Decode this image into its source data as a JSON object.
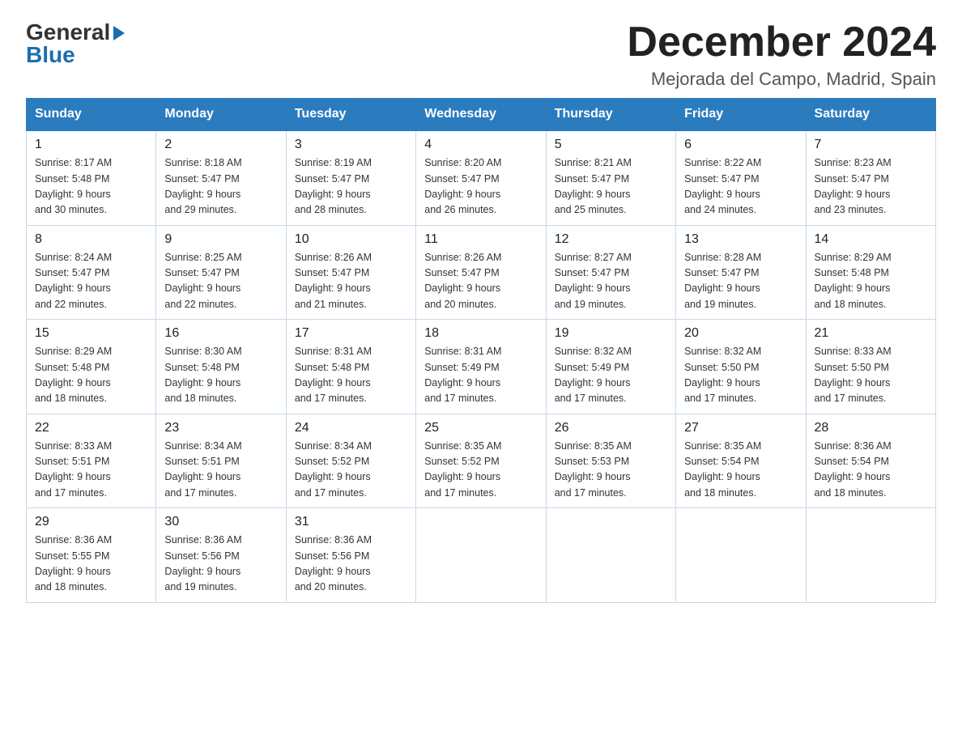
{
  "header": {
    "logo_general": "General",
    "logo_blue": "Blue",
    "month_title": "December 2024",
    "location": "Mejorada del Campo, Madrid, Spain"
  },
  "weekdays": [
    "Sunday",
    "Monday",
    "Tuesday",
    "Wednesday",
    "Thursday",
    "Friday",
    "Saturday"
  ],
  "weeks": [
    [
      {
        "day": "1",
        "sunrise": "8:17 AM",
        "sunset": "5:48 PM",
        "daylight": "9 hours and 30 minutes."
      },
      {
        "day": "2",
        "sunrise": "8:18 AM",
        "sunset": "5:47 PM",
        "daylight": "9 hours and 29 minutes."
      },
      {
        "day": "3",
        "sunrise": "8:19 AM",
        "sunset": "5:47 PM",
        "daylight": "9 hours and 28 minutes."
      },
      {
        "day": "4",
        "sunrise": "8:20 AM",
        "sunset": "5:47 PM",
        "daylight": "9 hours and 26 minutes."
      },
      {
        "day": "5",
        "sunrise": "8:21 AM",
        "sunset": "5:47 PM",
        "daylight": "9 hours and 25 minutes."
      },
      {
        "day": "6",
        "sunrise": "8:22 AM",
        "sunset": "5:47 PM",
        "daylight": "9 hours and 24 minutes."
      },
      {
        "day": "7",
        "sunrise": "8:23 AM",
        "sunset": "5:47 PM",
        "daylight": "9 hours and 23 minutes."
      }
    ],
    [
      {
        "day": "8",
        "sunrise": "8:24 AM",
        "sunset": "5:47 PM",
        "daylight": "9 hours and 22 minutes."
      },
      {
        "day": "9",
        "sunrise": "8:25 AM",
        "sunset": "5:47 PM",
        "daylight": "9 hours and 22 minutes."
      },
      {
        "day": "10",
        "sunrise": "8:26 AM",
        "sunset": "5:47 PM",
        "daylight": "9 hours and 21 minutes."
      },
      {
        "day": "11",
        "sunrise": "8:26 AM",
        "sunset": "5:47 PM",
        "daylight": "9 hours and 20 minutes."
      },
      {
        "day": "12",
        "sunrise": "8:27 AM",
        "sunset": "5:47 PM",
        "daylight": "9 hours and 19 minutes."
      },
      {
        "day": "13",
        "sunrise": "8:28 AM",
        "sunset": "5:47 PM",
        "daylight": "9 hours and 19 minutes."
      },
      {
        "day": "14",
        "sunrise": "8:29 AM",
        "sunset": "5:48 PM",
        "daylight": "9 hours and 18 minutes."
      }
    ],
    [
      {
        "day": "15",
        "sunrise": "8:29 AM",
        "sunset": "5:48 PM",
        "daylight": "9 hours and 18 minutes."
      },
      {
        "day": "16",
        "sunrise": "8:30 AM",
        "sunset": "5:48 PM",
        "daylight": "9 hours and 18 minutes."
      },
      {
        "day": "17",
        "sunrise": "8:31 AM",
        "sunset": "5:48 PM",
        "daylight": "9 hours and 17 minutes."
      },
      {
        "day": "18",
        "sunrise": "8:31 AM",
        "sunset": "5:49 PM",
        "daylight": "9 hours and 17 minutes."
      },
      {
        "day": "19",
        "sunrise": "8:32 AM",
        "sunset": "5:49 PM",
        "daylight": "9 hours and 17 minutes."
      },
      {
        "day": "20",
        "sunrise": "8:32 AM",
        "sunset": "5:50 PM",
        "daylight": "9 hours and 17 minutes."
      },
      {
        "day": "21",
        "sunrise": "8:33 AM",
        "sunset": "5:50 PM",
        "daylight": "9 hours and 17 minutes."
      }
    ],
    [
      {
        "day": "22",
        "sunrise": "8:33 AM",
        "sunset": "5:51 PM",
        "daylight": "9 hours and 17 minutes."
      },
      {
        "day": "23",
        "sunrise": "8:34 AM",
        "sunset": "5:51 PM",
        "daylight": "9 hours and 17 minutes."
      },
      {
        "day": "24",
        "sunrise": "8:34 AM",
        "sunset": "5:52 PM",
        "daylight": "9 hours and 17 minutes."
      },
      {
        "day": "25",
        "sunrise": "8:35 AM",
        "sunset": "5:52 PM",
        "daylight": "9 hours and 17 minutes."
      },
      {
        "day": "26",
        "sunrise": "8:35 AM",
        "sunset": "5:53 PM",
        "daylight": "9 hours and 17 minutes."
      },
      {
        "day": "27",
        "sunrise": "8:35 AM",
        "sunset": "5:54 PM",
        "daylight": "9 hours and 18 minutes."
      },
      {
        "day": "28",
        "sunrise": "8:36 AM",
        "sunset": "5:54 PM",
        "daylight": "9 hours and 18 minutes."
      }
    ],
    [
      {
        "day": "29",
        "sunrise": "8:36 AM",
        "sunset": "5:55 PM",
        "daylight": "9 hours and 18 minutes."
      },
      {
        "day": "30",
        "sunrise": "8:36 AM",
        "sunset": "5:56 PM",
        "daylight": "9 hours and 19 minutes."
      },
      {
        "day": "31",
        "sunrise": "8:36 AM",
        "sunset": "5:56 PM",
        "daylight": "9 hours and 20 minutes."
      },
      null,
      null,
      null,
      null
    ]
  ],
  "labels": {
    "sunrise": "Sunrise:",
    "sunset": "Sunset:",
    "daylight": "Daylight:"
  }
}
